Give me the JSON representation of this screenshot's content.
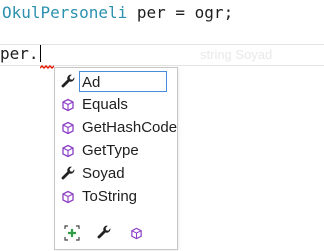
{
  "editor": {
    "line1": {
      "type": "OkulPersoneli",
      "rest": " per = ogr;"
    },
    "line2": {
      "text": "per."
    },
    "ghost_hint": "string Soyad"
  },
  "completion": {
    "items": [
      {
        "label": "Ad",
        "kind": "property",
        "icon": "wrench-icon",
        "selected": true
      },
      {
        "label": "Equals",
        "kind": "method",
        "icon": "method-cube-icon",
        "selected": false
      },
      {
        "label": "GetHashCode",
        "kind": "method",
        "icon": "method-cube-icon",
        "selected": false
      },
      {
        "label": "GetType",
        "kind": "method",
        "icon": "method-cube-icon",
        "selected": false
      },
      {
        "label": "Soyad",
        "kind": "property",
        "icon": "wrench-icon",
        "selected": false
      },
      {
        "label": "ToString",
        "kind": "method",
        "icon": "method-cube-icon",
        "selected": false
      }
    ],
    "filters": [
      "expand-members-icon",
      "properties-filter-icon",
      "methods-filter-icon"
    ]
  },
  "colors": {
    "type_name": "#2b91af",
    "method_icon": "#8b3fc6",
    "selection_border": "#4a8bdc",
    "expand_icon": "#2f9e44",
    "error_squiggle": "#e51400"
  }
}
